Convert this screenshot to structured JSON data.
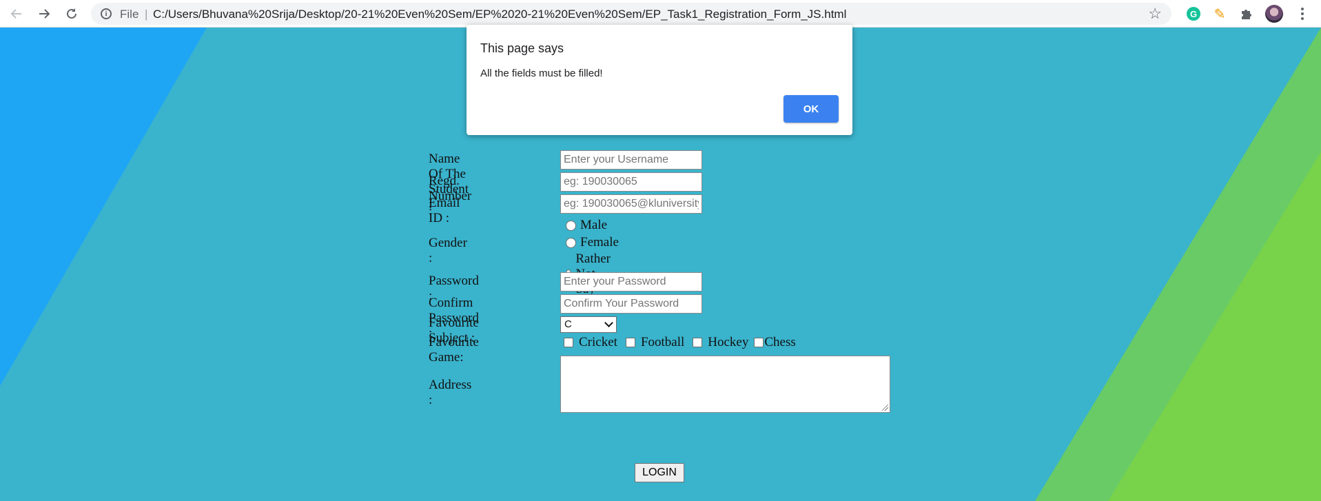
{
  "browser": {
    "url_scheme_label": "File",
    "url": "C:/Users/Bhuvana%20Srija/Desktop/20-21%20Even%20Sem/EP%2020-21%20Even%20Sem/EP_Task1_Registration_Form_JS.html",
    "icons": [
      "back-arrow-icon",
      "forward-arrow-icon",
      "reload-icon",
      "info-icon",
      "bookmark-star-icon",
      "grammarly-icon",
      "pencil-icon",
      "extensions-puzzle-icon",
      "profile-avatar",
      "menu-dots-icon"
    ],
    "grammarly_glyph": "G"
  },
  "background": {
    "base_color": "#3ab3cc",
    "left_wedge_color": "#1ea6f5",
    "right_band_color": "#68cb66",
    "right_corner_color": "#78d24a"
  },
  "dialog": {
    "title": "This page says",
    "message": "All the fields must be filled!",
    "ok_label": "OK",
    "ok_color": "#3b82f0"
  },
  "form": {
    "name_label": "Name Of The Student :",
    "name_placeholder": "Enter your Username",
    "regd_label": "Regd. Number :",
    "regd_placeholder": "eg: 190030065",
    "email_label": "Email ID :",
    "email_placeholder": "eg: 190030065@kluniversity.in",
    "gender_label": "Gender :",
    "gender_options": [
      "Male",
      "Female",
      "Rather Not Say"
    ],
    "password_label": "Password :",
    "password_placeholder": "Enter your Password",
    "confirm_label": "Confirm Password :",
    "confirm_placeholder": "Confirm Your Password",
    "subject_label": "Favourite Subject :",
    "subject_value": "C",
    "game_label": "Favourite Game:",
    "games": [
      "Cricket",
      "Football",
      "Hockey",
      "Chess"
    ],
    "address_label": "Address :",
    "login_label": "LOGIN"
  }
}
